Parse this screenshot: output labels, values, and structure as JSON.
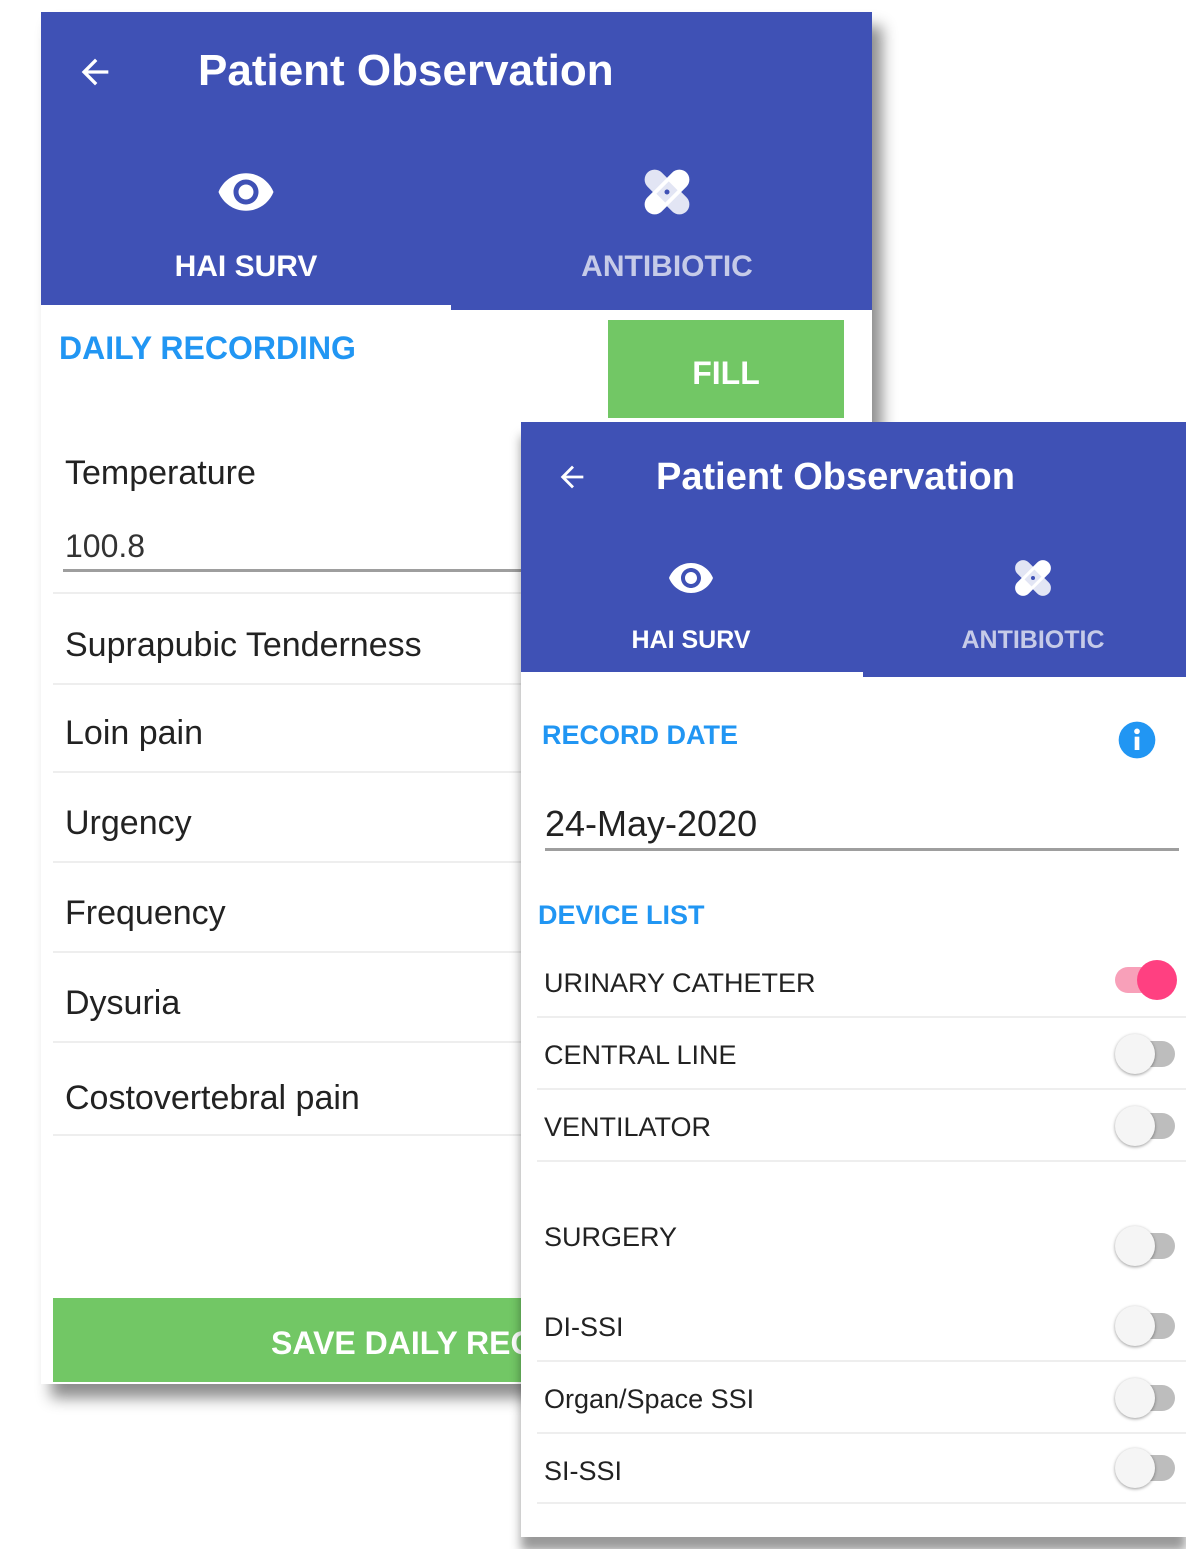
{
  "colors": {
    "appbar": "#3f51b5",
    "section_title": "#2196f3",
    "primary_button": "#72c765",
    "switch_on": "#ff4081",
    "info_icon": "#2196f3"
  },
  "screen_daily": {
    "header": {
      "title": "Patient Observation",
      "back_icon": "arrow-back-icon"
    },
    "tabs": [
      {
        "label": "HAI SURV",
        "icon": "eye-icon",
        "selected": true
      },
      {
        "label": "ANTIBIOTIC",
        "icon": "bandage-icon",
        "selected": false
      }
    ],
    "section_title": "DAILY RECORDING",
    "fill_label": "FILL",
    "temperature": {
      "label": "Temperature",
      "value": "100.8"
    },
    "symptoms": [
      "Suprapubic Tenderness",
      "Loin pain",
      "Urgency",
      "Frequency",
      "Dysuria",
      "Costovertebral pain"
    ],
    "save_label": "SAVE DAILY RECORD"
  },
  "screen_devices": {
    "header": {
      "title": "Patient Observation",
      "back_icon": "arrow-back-icon"
    },
    "tabs": [
      {
        "label": "HAI SURV",
        "icon": "eye-icon",
        "selected": true
      },
      {
        "label": "ANTIBIOTIC",
        "icon": "bandage-icon",
        "selected": false
      }
    ],
    "record_date_title": "RECORD DATE",
    "info_icon": "info-icon",
    "record_date_value": "24-May-2020",
    "device_list_title": "DEVICE LIST",
    "devices": [
      {
        "label": "URINARY CATHETER",
        "on": true
      },
      {
        "label": "CENTRAL LINE",
        "on": false
      },
      {
        "label": "VENTILATOR",
        "on": false
      },
      {
        "label": "SURGERY",
        "on": false
      },
      {
        "label": "DI-SSI",
        "on": false
      },
      {
        "label": "Organ/Space SSI",
        "on": false
      },
      {
        "label": "SI-SSI",
        "on": false
      }
    ]
  }
}
